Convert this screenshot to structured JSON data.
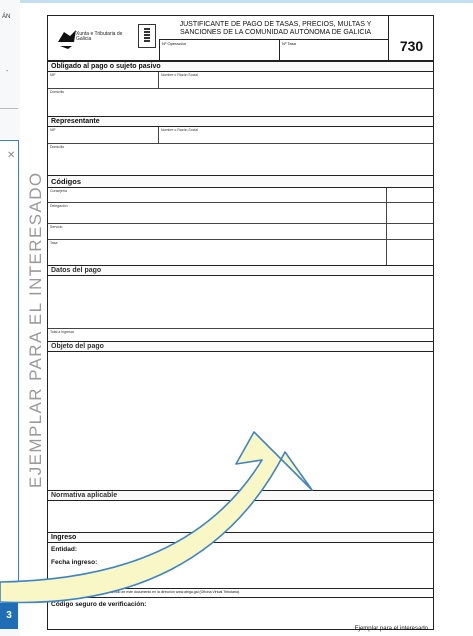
{
  "left_panel": {
    "snippet": "ÁN",
    "dash": "-",
    "close_glyph": "✕",
    "button_label": "3"
  },
  "side_text": "EJEMPLAR PARA EL INTERESADO",
  "form": {
    "logo_text": "Xunta e Tributaria de Galicia",
    "title": "JUSTIFICANTE DE PAGO DE TASAS, PRECIOS, MULTAS Y SANCIONES DE LA COMUNIDAD AUTÓNOMA DE GALICIA",
    "number": "730",
    "operacion_label": "Nº Operación",
    "tasa_label": "Nº Tasa",
    "obligado": {
      "heading": "Obligado al pago o sujeto pasivo",
      "nif": "NIF",
      "nombre": "Nombre o Razón Social",
      "domicilio": "Domicilio"
    },
    "representante": {
      "heading": "Representante",
      "nif": "NIF",
      "nombre": "Nombre o Razón Social",
      "domicilio": "Domicilio"
    },
    "codigos": {
      "heading": "Códigos",
      "rows": [
        "Consejería",
        "Delegación",
        "Servicio",
        "Tasa"
      ]
    },
    "datos_pago": {
      "heading": "Datos del pago",
      "total": "Total a ingresar"
    },
    "objeto_pago": {
      "heading": "Objeto del pago"
    },
    "normativa": {
      "heading": "Normativa aplicable"
    },
    "ingreso": {
      "heading": "Ingreso",
      "entidad": "Entidad:",
      "fecha": "Fecha ingreso:"
    },
    "verificacion_note": "Puede comprobar la veracidad del contenido de este documento en la dirección www.atriga.gal (Oficina Virtual Tributaria).",
    "codigo_seguro": "Código seguro de verificación:"
  },
  "footer_note": "Ejemplar para el interesado",
  "colors": {
    "arrow_fill": "#f9f7c5",
    "arrow_stroke": "#3f84c5",
    "accent": "#1f6db5"
  }
}
